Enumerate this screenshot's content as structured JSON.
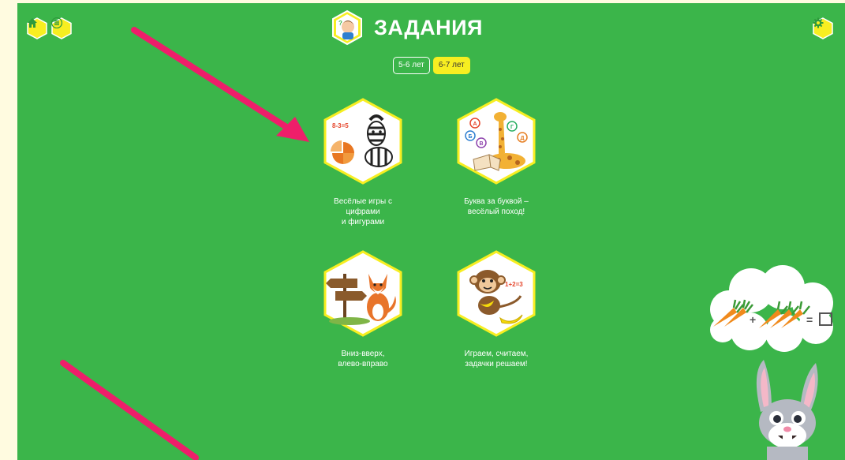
{
  "header": {
    "title": "ЗАДАНИЯ",
    "home_icon": "home-icon",
    "menu_icon": "menu-icon",
    "settings_icon": "gear-icon"
  },
  "age_tabs": [
    {
      "label": "5-6 лет",
      "active": false
    },
    {
      "label": "6-7 лет",
      "active": true
    }
  ],
  "tasks": [
    {
      "label": "Весёлые игры с\nцифрами\nи фигурами",
      "image": "zebra-math-icon"
    },
    {
      "label": "Буква за буквой –\nвесёлый поход!",
      "image": "giraffe-letters-icon"
    },
    {
      "label": "Вниз-вверх,\nвлево-вправо",
      "image": "fox-directions-icon"
    },
    {
      "label": "Играем, считаем,\nзадачки решаем!",
      "image": "monkey-count-icon"
    }
  ],
  "mascot": {
    "name": "rabbit-mascot"
  },
  "colors": {
    "background": "#3bb54a",
    "accent": "#f7ee21",
    "arrow": "#ee1e6a"
  }
}
